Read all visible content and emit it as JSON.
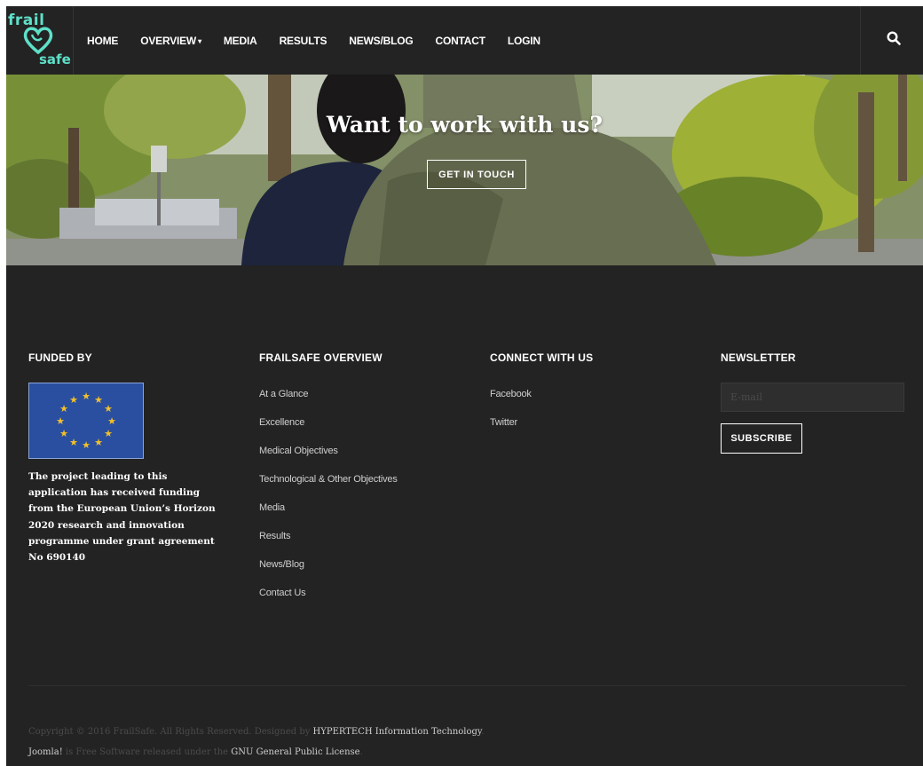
{
  "logo": {
    "line1": "frail",
    "line2": "safe"
  },
  "nav": {
    "items": [
      {
        "label": "HOME"
      },
      {
        "label": "OVERVIEW",
        "has_dropdown": true
      },
      {
        "label": "MEDIA"
      },
      {
        "label": "RESULTS"
      },
      {
        "label": "NEWS/BLOG"
      },
      {
        "label": "CONTACT"
      },
      {
        "label": "LOGIN"
      }
    ],
    "dropdown_caret": "▾",
    "search_icon": "search-icon"
  },
  "hero": {
    "title": "Want to work with us?",
    "button": "GET IN TOUCH"
  },
  "footer": {
    "funded": {
      "heading": "FUNDED BY",
      "flag": "eu-flag",
      "text": "The project leading to this application has received funding from the European Union’s Horizon 2020 research and innovation programme under grant agreement No 690140"
    },
    "overview": {
      "heading": "FRAILSAFE OVERVIEW",
      "links": [
        "At a Glance",
        "Excellence",
        "Medical Objectives",
        "Technological & Other Objectives",
        "Media",
        "Results",
        "News/Blog",
        "Contact Us"
      ]
    },
    "connect": {
      "heading": "CONNECT WITH US",
      "links": [
        "Facebook",
        "Twitter"
      ]
    },
    "newsletter": {
      "heading": "NEWSLETTER",
      "email_placeholder": "E-mail",
      "email_value": "",
      "subscribe": "SUBSCRIBE"
    },
    "copyright": {
      "line1_pre": "Copyright © 2016 FrailSafe. All Rights Reserved. Designed by ",
      "line1_link": "HYPERTECH Information Technology",
      "line1_post": ".",
      "line2_link1": "Joomla!",
      "line2_mid": " is Free Software released under the ",
      "line2_link2": "GNU General Public License",
      "line2_post": "."
    }
  },
  "colors": {
    "background": "#232323",
    "logo_teal": "#5ee0c8",
    "text": "#ffffff",
    "muted": "#4b4b4b",
    "eu_blue": "#2a4fa0",
    "eu_star": "#f2c02a"
  }
}
